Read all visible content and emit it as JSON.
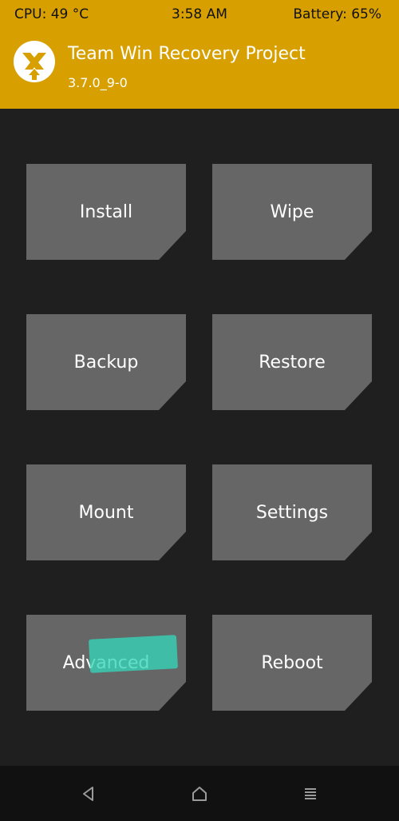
{
  "status_bar": {
    "cpu": "CPU: 49 °C",
    "time": "3:58 AM",
    "battery": "Battery: 65%"
  },
  "header": {
    "title": "Team Win Recovery Project",
    "version": "3.7.0_9-0",
    "logo_icon": "twrp-logo-icon"
  },
  "menu": {
    "install": "Install",
    "wipe": "Wipe",
    "backup": "Backup",
    "restore": "Restore",
    "mount": "Mount",
    "settings": "Settings",
    "advanced": "Advanced",
    "reboot": "Reboot"
  },
  "nav_bar": {
    "back_icon": "back-triangle-icon",
    "home_icon": "home-icon",
    "menu_icon": "menu-lines-icon"
  },
  "colors": {
    "accent": "#d7a000",
    "background": "#1f1f1f",
    "tile": "#666666",
    "nav_bar": "#111111",
    "touch_highlight": "#34d6b8"
  }
}
